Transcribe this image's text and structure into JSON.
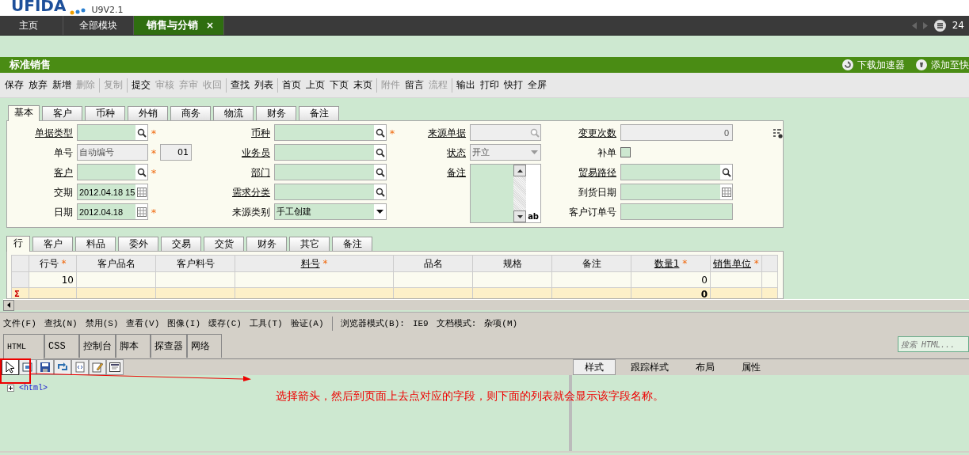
{
  "header": {
    "logo": "UFIDA",
    "version": "U9V2.1"
  },
  "nav_tabs": [
    {
      "label": "主页",
      "selected": false
    },
    {
      "label": "全部模块",
      "selected": false
    },
    {
      "label": "销售与分销",
      "selected": true,
      "close": "×"
    }
  ],
  "nav_count": "24",
  "page_title": "标准销售",
  "title_actions": [
    {
      "label": "下载加速器"
    },
    {
      "label": "添加至快"
    }
  ],
  "toolbar": [
    [
      {
        "label": "保存",
        "disabled": false
      },
      {
        "label": "放弃",
        "disabled": false
      },
      {
        "label": "新增",
        "disabled": false
      },
      {
        "label": "删除",
        "disabled": true
      }
    ],
    [
      {
        "label": "复制",
        "disabled": true
      }
    ],
    [
      {
        "label": "提交",
        "disabled": false
      },
      {
        "label": "审核",
        "disabled": true
      },
      {
        "label": "弃审",
        "disabled": true
      },
      {
        "label": "收回",
        "disabled": true
      }
    ],
    [
      {
        "label": "查找",
        "disabled": false
      },
      {
        "label": "列表",
        "disabled": false
      }
    ],
    [
      {
        "label": "首页",
        "disabled": false
      },
      {
        "label": "上页",
        "disabled": false
      },
      {
        "label": "下页",
        "disabled": false
      },
      {
        "label": "末页",
        "disabled": false
      }
    ],
    [
      {
        "label": "附件",
        "disabled": true
      },
      {
        "label": "留言",
        "disabled": false
      },
      {
        "label": "流程",
        "disabled": true
      }
    ],
    [
      {
        "label": "输出",
        "disabled": false
      },
      {
        "label": "打印",
        "disabled": false
      },
      {
        "label": "快打",
        "disabled": false
      },
      {
        "label": "全屏",
        "disabled": false
      }
    ]
  ],
  "form_tabs": [
    {
      "label": "基本",
      "selected": true
    },
    {
      "label": "客户",
      "selected": false
    },
    {
      "label": "币种",
      "selected": false
    },
    {
      "label": "外销",
      "selected": false
    },
    {
      "label": "商务",
      "selected": false
    },
    {
      "label": "物流",
      "selected": false
    },
    {
      "label": "财务",
      "selected": false
    },
    {
      "label": "备注",
      "selected": false
    }
  ],
  "form": {
    "columns": [
      [
        {
          "label": "单据类型",
          "link": true,
          "kind": "lookup",
          "mark": "*",
          "disabled": false
        },
        {
          "label": "单号",
          "link": false,
          "kind": "text",
          "value": "自动编号",
          "mark": "*",
          "disabled": true,
          "extra": "01"
        },
        {
          "label": "客户",
          "link": true,
          "kind": "lookup",
          "mark": "*",
          "disabled": false
        },
        {
          "label": "交期",
          "link": false,
          "kind": "date",
          "value": "2012.04.18 15",
          "disabled": false
        },
        {
          "label": "日期",
          "link": false,
          "kind": "date",
          "value": "2012.04.18",
          "mark": "*",
          "disabled": false
        }
      ],
      [
        {
          "label": "币种",
          "link": true,
          "kind": "lookup",
          "mark": "*",
          "disabled": false
        },
        {
          "label": "业务员",
          "link": true,
          "kind": "lookup",
          "disabled": false
        },
        {
          "label": "部门",
          "link": true,
          "kind": "lookup",
          "disabled": false
        },
        {
          "label": "需求分类",
          "link": true,
          "kind": "lookup",
          "disabled": false
        },
        {
          "label": "来源类别",
          "link": false,
          "kind": "select",
          "value": "手工创建",
          "disabled": false
        }
      ],
      [
        {
          "label": "来源单据",
          "link": true,
          "kind": "lookup",
          "disabled": true
        },
        {
          "label": "状态",
          "link": true,
          "kind": "select",
          "value": "开立",
          "disabled": true
        },
        {
          "label": "备注",
          "link": true,
          "kind": "memo",
          "marker": "ab",
          "disabled": false
        }
      ],
      [
        {
          "label": "变更次数",
          "link": true,
          "kind": "number",
          "value": "0",
          "disabled": true
        },
        {
          "label": "补单",
          "link": false,
          "kind": "checkbox",
          "checked": false,
          "disabled": false
        },
        {
          "label": "贸易路径",
          "link": true,
          "kind": "lookup",
          "disabled": false
        },
        {
          "label": "到货日期",
          "link": false,
          "kind": "date",
          "disabled": false
        },
        {
          "label": "客户订单号",
          "link": false,
          "kind": "text",
          "disabled": false
        }
      ]
    ]
  },
  "grid_tabs": [
    {
      "label": "行",
      "selected": true
    },
    {
      "label": "客户",
      "selected": false
    },
    {
      "label": "料品",
      "selected": false
    },
    {
      "label": "委外",
      "selected": false
    },
    {
      "label": "交易",
      "selected": false
    },
    {
      "label": "交货",
      "selected": false
    },
    {
      "label": "财务",
      "selected": false
    },
    {
      "label": "其它",
      "selected": false
    },
    {
      "label": "备注",
      "selected": false
    }
  ],
  "grid": {
    "columns": [
      {
        "label": "行号",
        "mark": "*",
        "link": false
      },
      {
        "label": "客户品名",
        "link": false
      },
      {
        "label": "客户料号",
        "link": false
      },
      {
        "label": "料号",
        "mark": "*",
        "link": true
      },
      {
        "label": "品名",
        "link": false
      },
      {
        "label": "规格",
        "link": false
      },
      {
        "label": "备注",
        "link": false
      },
      {
        "label": "数量1",
        "mark": "*",
        "link": true,
        "total": "0"
      },
      {
        "label": "销售单位",
        "mark": "*",
        "link": true
      }
    ],
    "rows": [
      [
        "10",
        null,
        null,
        null,
        null,
        null,
        null,
        "0",
        null
      ]
    ],
    "sum_marker": "Σ"
  },
  "devtools": {
    "menu": [
      "文件(F)",
      "查找(N)",
      "禁用(S)",
      "查看(V)",
      "图像(I)",
      "缓存(C)",
      "工具(T)",
      "验证(A)"
    ],
    "modes": [
      "浏览器模式(B):",
      "IE9",
      "文档模式:",
      "杂项(M)"
    ],
    "tabs": [
      {
        "label": "HTML",
        "selected": true
      },
      {
        "label": "CSS",
        "selected": false
      },
      {
        "label": "控制台",
        "selected": false
      },
      {
        "label": "脚本",
        "selected": false
      },
      {
        "label": "探查器",
        "selected": false
      },
      {
        "label": "网络",
        "selected": false
      }
    ],
    "search": {
      "placeholder": "搜索 HTML..."
    },
    "tools": [
      {
        "kind": "pointer",
        "selected": true
      },
      {
        "kind": "select",
        "selected": false
      },
      {
        "kind": "save",
        "selected": false
      },
      {
        "kind": "refresh",
        "selected": false
      },
      {
        "kind": "source",
        "selected": false
      },
      {
        "kind": "edit",
        "selected": false
      },
      {
        "kind": "window",
        "selected": false
      }
    ],
    "side_tabs": [
      {
        "label": "样式",
        "selected": true
      },
      {
        "label": "跟踪样式",
        "selected": false
      },
      {
        "label": "布局",
        "selected": false
      },
      {
        "label": "属性",
        "selected": false
      }
    ],
    "tree": [
      {
        "label": "<html>",
        "expanded": false
      }
    ],
    "annotation": "选择箭头，然后到页面上去点对应的字段，则下面的列表就会显示该字段名称。"
  }
}
